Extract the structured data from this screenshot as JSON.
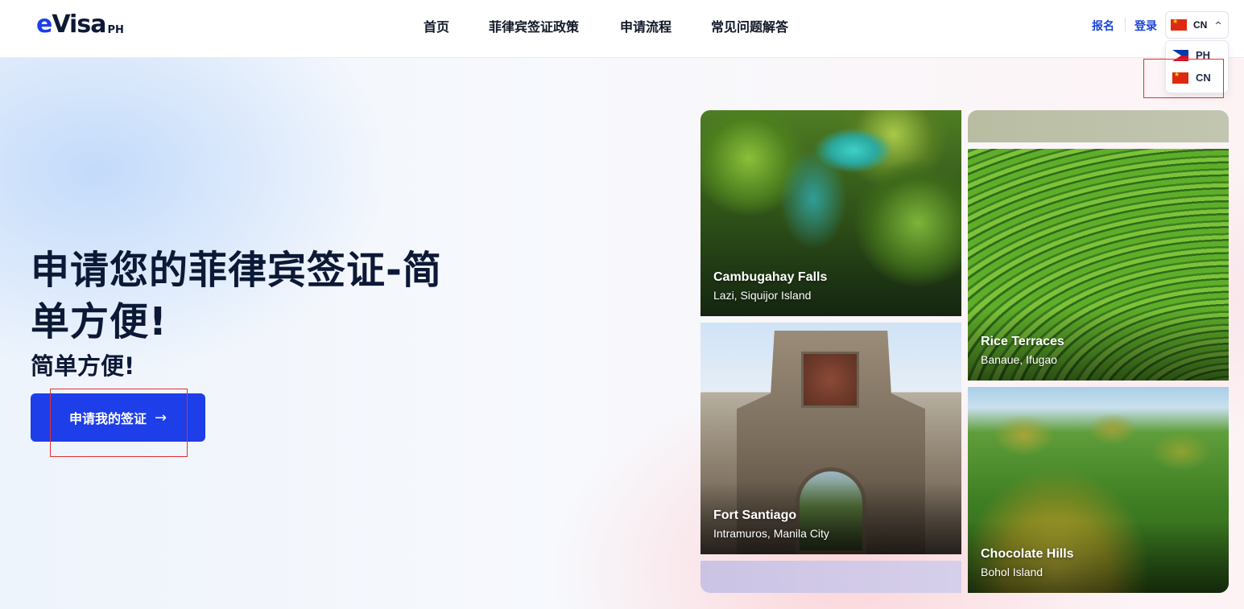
{
  "header": {
    "logo": {
      "e": "e",
      "visa": "Visa",
      "ph": "PH"
    },
    "nav": [
      {
        "label": "首页"
      },
      {
        "label": "菲律宾签证政策"
      },
      {
        "label": "申请流程"
      },
      {
        "label": "常见问题解答"
      }
    ],
    "signup": "报名",
    "login": "登录",
    "language": {
      "selected": "CN",
      "options": [
        {
          "code": "PH",
          "flag": "flag-philippines"
        },
        {
          "code": "CN",
          "flag": "flag-china"
        }
      ]
    }
  },
  "hero": {
    "title": "申请您的菲律宾签证-简单方便!",
    "subtitle": "简单方便!",
    "cta_label": "申请我的签证",
    "cta_icon": "arrow-right-icon"
  },
  "gallery": [
    {
      "title": "Cambugahay Falls",
      "location": "Lazi, Siquijor Island"
    },
    {
      "title": "Rice Terraces",
      "location": "Banaue, Ifugao"
    },
    {
      "title": "Fort Santiago",
      "location": "Intramuros, Manila City"
    },
    {
      "title": "Chocolate Hills",
      "location": "Bohol Island"
    }
  ],
  "colors": {
    "brand_blue": "#1d3ee8",
    "text_dark": "#0c1936",
    "annotation_red": "#e03131"
  }
}
